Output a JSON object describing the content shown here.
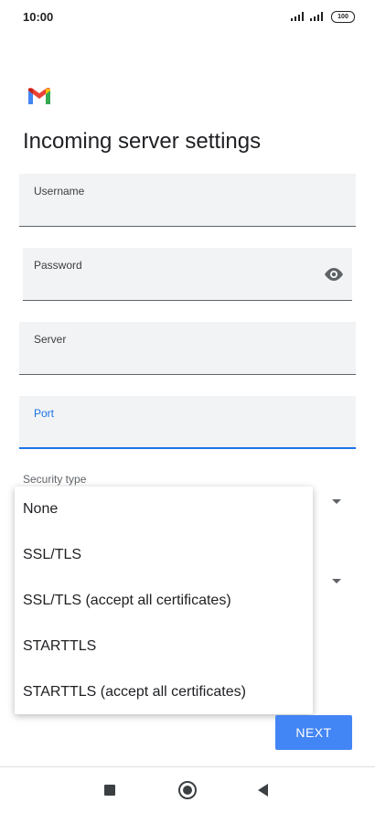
{
  "status_bar": {
    "time": "10:00",
    "battery": "100"
  },
  "app": {
    "logo_icon": "gmail-logo",
    "title": "Incoming server settings"
  },
  "form": {
    "username_label": "Username",
    "password_label": "Password",
    "password_toggle_icon": "eye-icon",
    "server_label": "Server",
    "port_label": "Port",
    "security_type_label": "Security type"
  },
  "dropdown": {
    "options": [
      "None",
      "SSL/TLS",
      "SSL/TLS (accept all certificates)",
      "STARTTLS",
      "STARTTLS (accept all certificates)"
    ]
  },
  "actions": {
    "next_label": "NEXT"
  },
  "colors": {
    "accent": "#1a73e8",
    "button": "#4285f4",
    "field_bg": "#f1f3f4"
  }
}
